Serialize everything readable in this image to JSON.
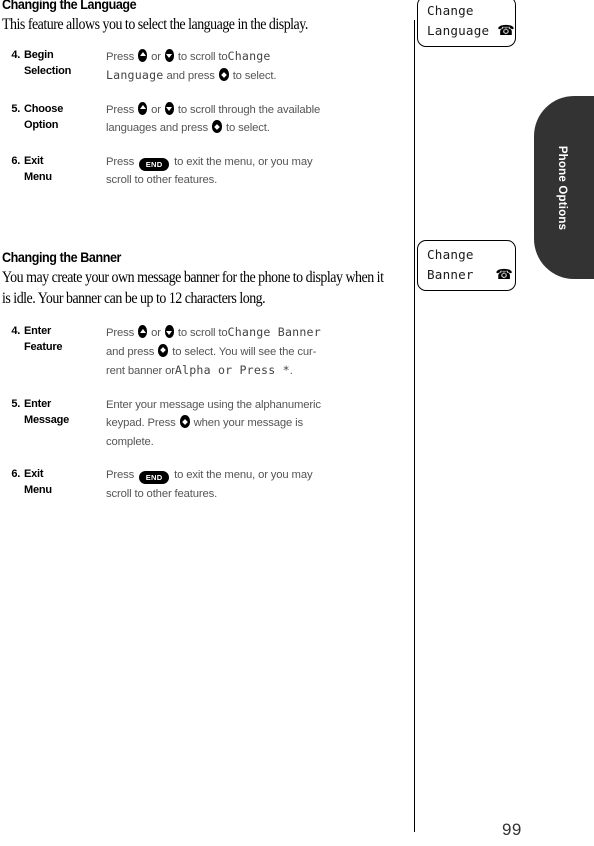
{
  "page": {
    "number": "99",
    "side_tab": "Phone Options"
  },
  "sections": [
    {
      "heading": "Changing the Language",
      "intro": "This feature allows you to select the language in the display.",
      "steps": [
        {
          "num": "4.",
          "label_line1": "Begin",
          "label_line2": "Selection",
          "lines": [
            [
              {
                "t": "text",
                "v": "Press "
              },
              {
                "t": "key",
                "v": "scroll-up"
              },
              {
                "t": "text",
                "v": " or "
              },
              {
                "t": "key",
                "v": "scroll-down"
              },
              {
                "t": "text",
                "v": " to scroll to"
              },
              {
                "t": "lcd",
                "v": "Change"
              }
            ],
            [
              {
                "t": "lcd",
                "v": "Language"
              },
              {
                "t": "text",
                "v": " and press "
              },
              {
                "t": "key",
                "v": "select"
              },
              {
                "t": "text",
                "v": " to select."
              }
            ]
          ]
        },
        {
          "num": "5.",
          "label_line1": "Choose",
          "label_line2": "Option",
          "lines": [
            [
              {
                "t": "text",
                "v": "Press "
              },
              {
                "t": "key",
                "v": "scroll-up"
              },
              {
                "t": "text",
                "v": " or "
              },
              {
                "t": "key",
                "v": "scroll-down"
              },
              {
                "t": "text",
                "v": " to scroll through the available"
              }
            ],
            [
              {
                "t": "text",
                "v": "languages and press "
              },
              {
                "t": "key",
                "v": "select"
              },
              {
                "t": "text",
                "v": " to select."
              }
            ]
          ]
        },
        {
          "num": "6.",
          "label_line1": "Exit",
          "label_line2": "Menu",
          "lines": [
            [
              {
                "t": "text",
                "v": "Press "
              },
              {
                "t": "key",
                "v": "end",
                "label": "END"
              },
              {
                "t": "text",
                "v": " to exit the menu, or you may"
              }
            ],
            [
              {
                "t": "text",
                "v": "scroll to other features."
              }
            ]
          ]
        }
      ]
    },
    {
      "heading": "Changing the Banner",
      "intro": "You may create your own message banner for the phone to display when it is idle. Your banner can be up to 12 characters long.",
      "steps": [
        {
          "num": "4.",
          "label_line1": "Enter",
          "label_line2": "Feature",
          "lines": [
            [
              {
                "t": "text",
                "v": "Press "
              },
              {
                "t": "key",
                "v": "scroll-up"
              },
              {
                "t": "text",
                "v": " or "
              },
              {
                "t": "key",
                "v": "scroll-down"
              },
              {
                "t": "text",
                "v": " to scroll to"
              },
              {
                "t": "lcd",
                "v": "Change Banner"
              }
            ],
            [
              {
                "t": "text",
                "v": "and press "
              },
              {
                "t": "key",
                "v": "select"
              },
              {
                "t": "text",
                "v": " to select. You will see the cur-"
              }
            ],
            [
              {
                "t": "text",
                "v": "rent banner or"
              },
              {
                "t": "lcd",
                "v": "Alpha or Press *"
              },
              {
                "t": "text",
                "v": "."
              }
            ]
          ]
        },
        {
          "num": "5.",
          "label_line1": "Enter",
          "label_line2": "Message",
          "lines": [
            [
              {
                "t": "text",
                "v": "Enter your message using the alphanumeric"
              }
            ],
            [
              {
                "t": "text",
                "v": "keypad. Press "
              },
              {
                "t": "key",
                "v": "select"
              },
              {
                "t": "text",
                "v": " when your message is"
              }
            ],
            [
              {
                "t": "text",
                "v": "complete."
              }
            ]
          ]
        },
        {
          "num": "6.",
          "label_line1": "Exit",
          "label_line2": "Menu",
          "lines": [
            [
              {
                "t": "text",
                "v": "Press "
              },
              {
                "t": "key",
                "v": "end",
                "label": "END"
              },
              {
                "t": "text",
                "v": " to exit the menu, or you may"
              }
            ],
            [
              {
                "t": "text",
                "v": "scroll to other features."
              }
            ]
          ]
        }
      ]
    }
  ],
  "margin_screens": [
    {
      "line1": "Change",
      "line2": "Language",
      "icon": "☎",
      "icon_name": "telephone-icon"
    },
    {
      "line1": "Change",
      "line2": "Banner",
      "icon": "☎",
      "icon_name": "telephone-icon"
    }
  ]
}
